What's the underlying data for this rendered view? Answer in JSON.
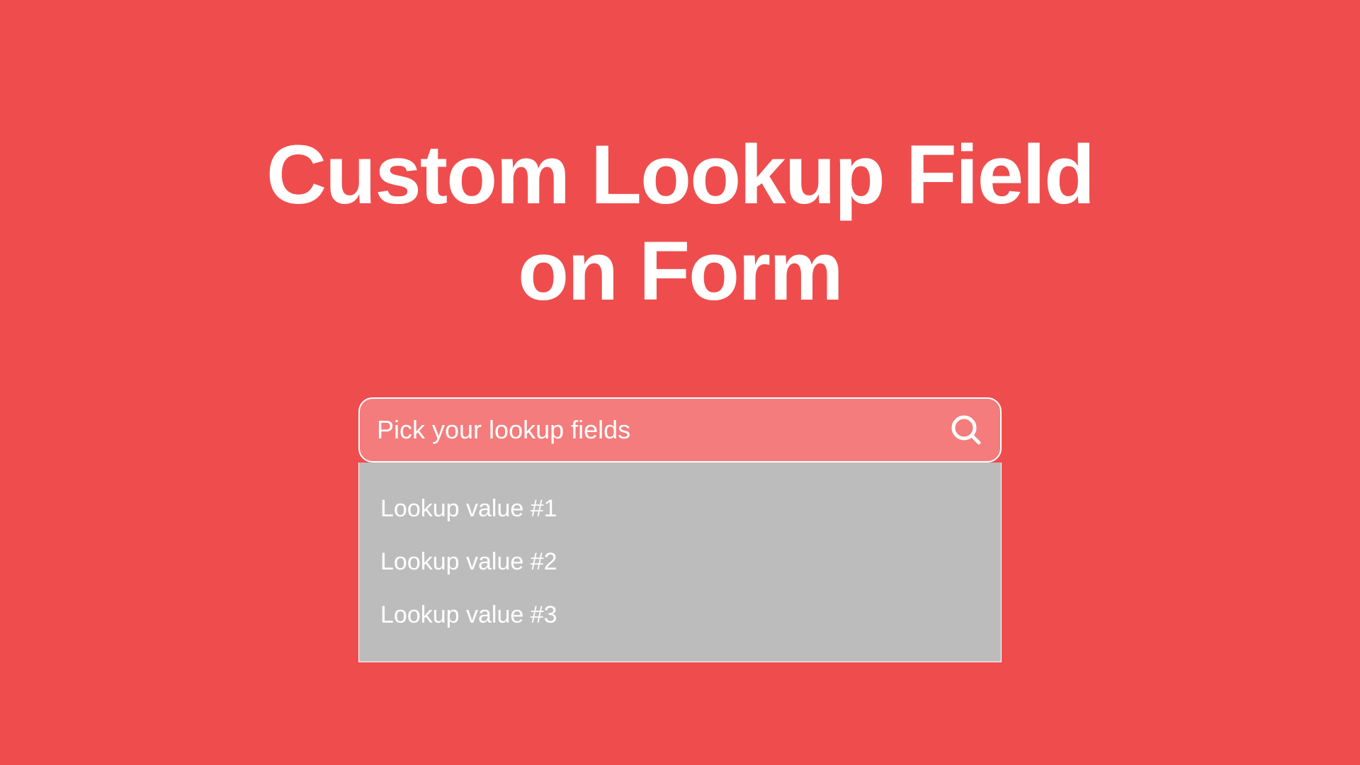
{
  "heading": {
    "line1": "Custom Lookup Field",
    "line2": "on Form"
  },
  "lookup": {
    "placeholder": "Pick your lookup fields",
    "options": [
      "Lookup value #1",
      "Lookup value #2",
      "Lookup value #3"
    ]
  }
}
